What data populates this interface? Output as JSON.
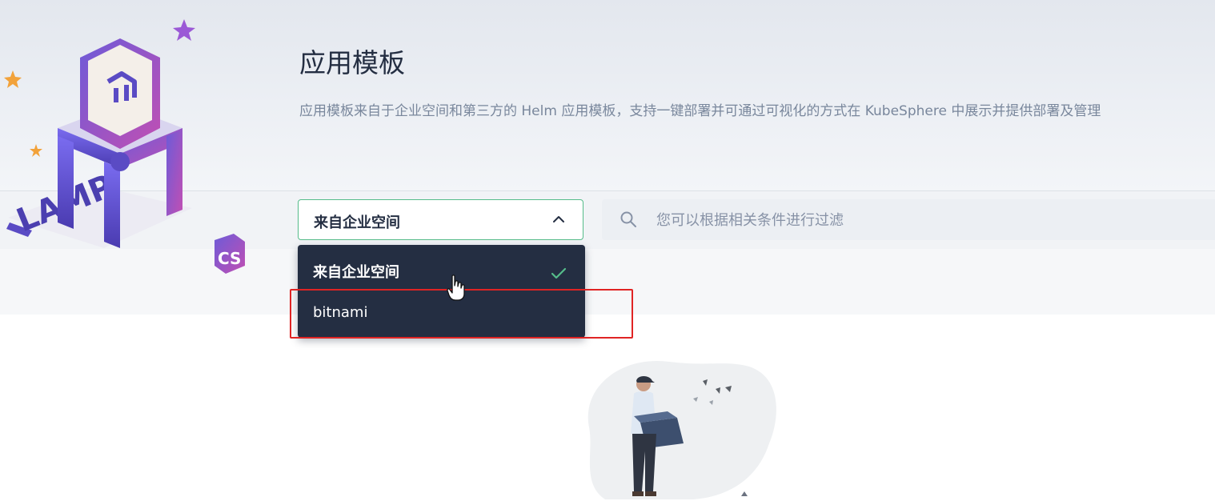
{
  "header": {
    "title": "应用模板",
    "description": "应用模板来自于企业空间和第三方的 Helm 应用模板，支持一键部署并可通过可视化的方式在 KubeSphere 中展示并提供部署及管理"
  },
  "hero": {
    "badge_text": "CS",
    "floor_letters": "LAMP"
  },
  "toolbar": {
    "source_select": {
      "value": "来自企业空间",
      "expanded": true,
      "options": [
        {
          "label": "来自企业空间",
          "selected": true
        },
        {
          "label": "bitnami",
          "selected": false
        }
      ]
    },
    "search": {
      "placeholder": "您可以根据相关条件进行过滤",
      "value": ""
    }
  },
  "icons": {
    "select_arrow": "chevron-up-icon",
    "search": "search-icon",
    "selected_check": "check-icon",
    "cursor": "hand-pointer-icon"
  },
  "colors": {
    "title": "#242e42",
    "select_border": "#55bc8a",
    "dropdown_bg": "#242e42",
    "check": "#55bc8a",
    "highlight": "#e02424"
  }
}
